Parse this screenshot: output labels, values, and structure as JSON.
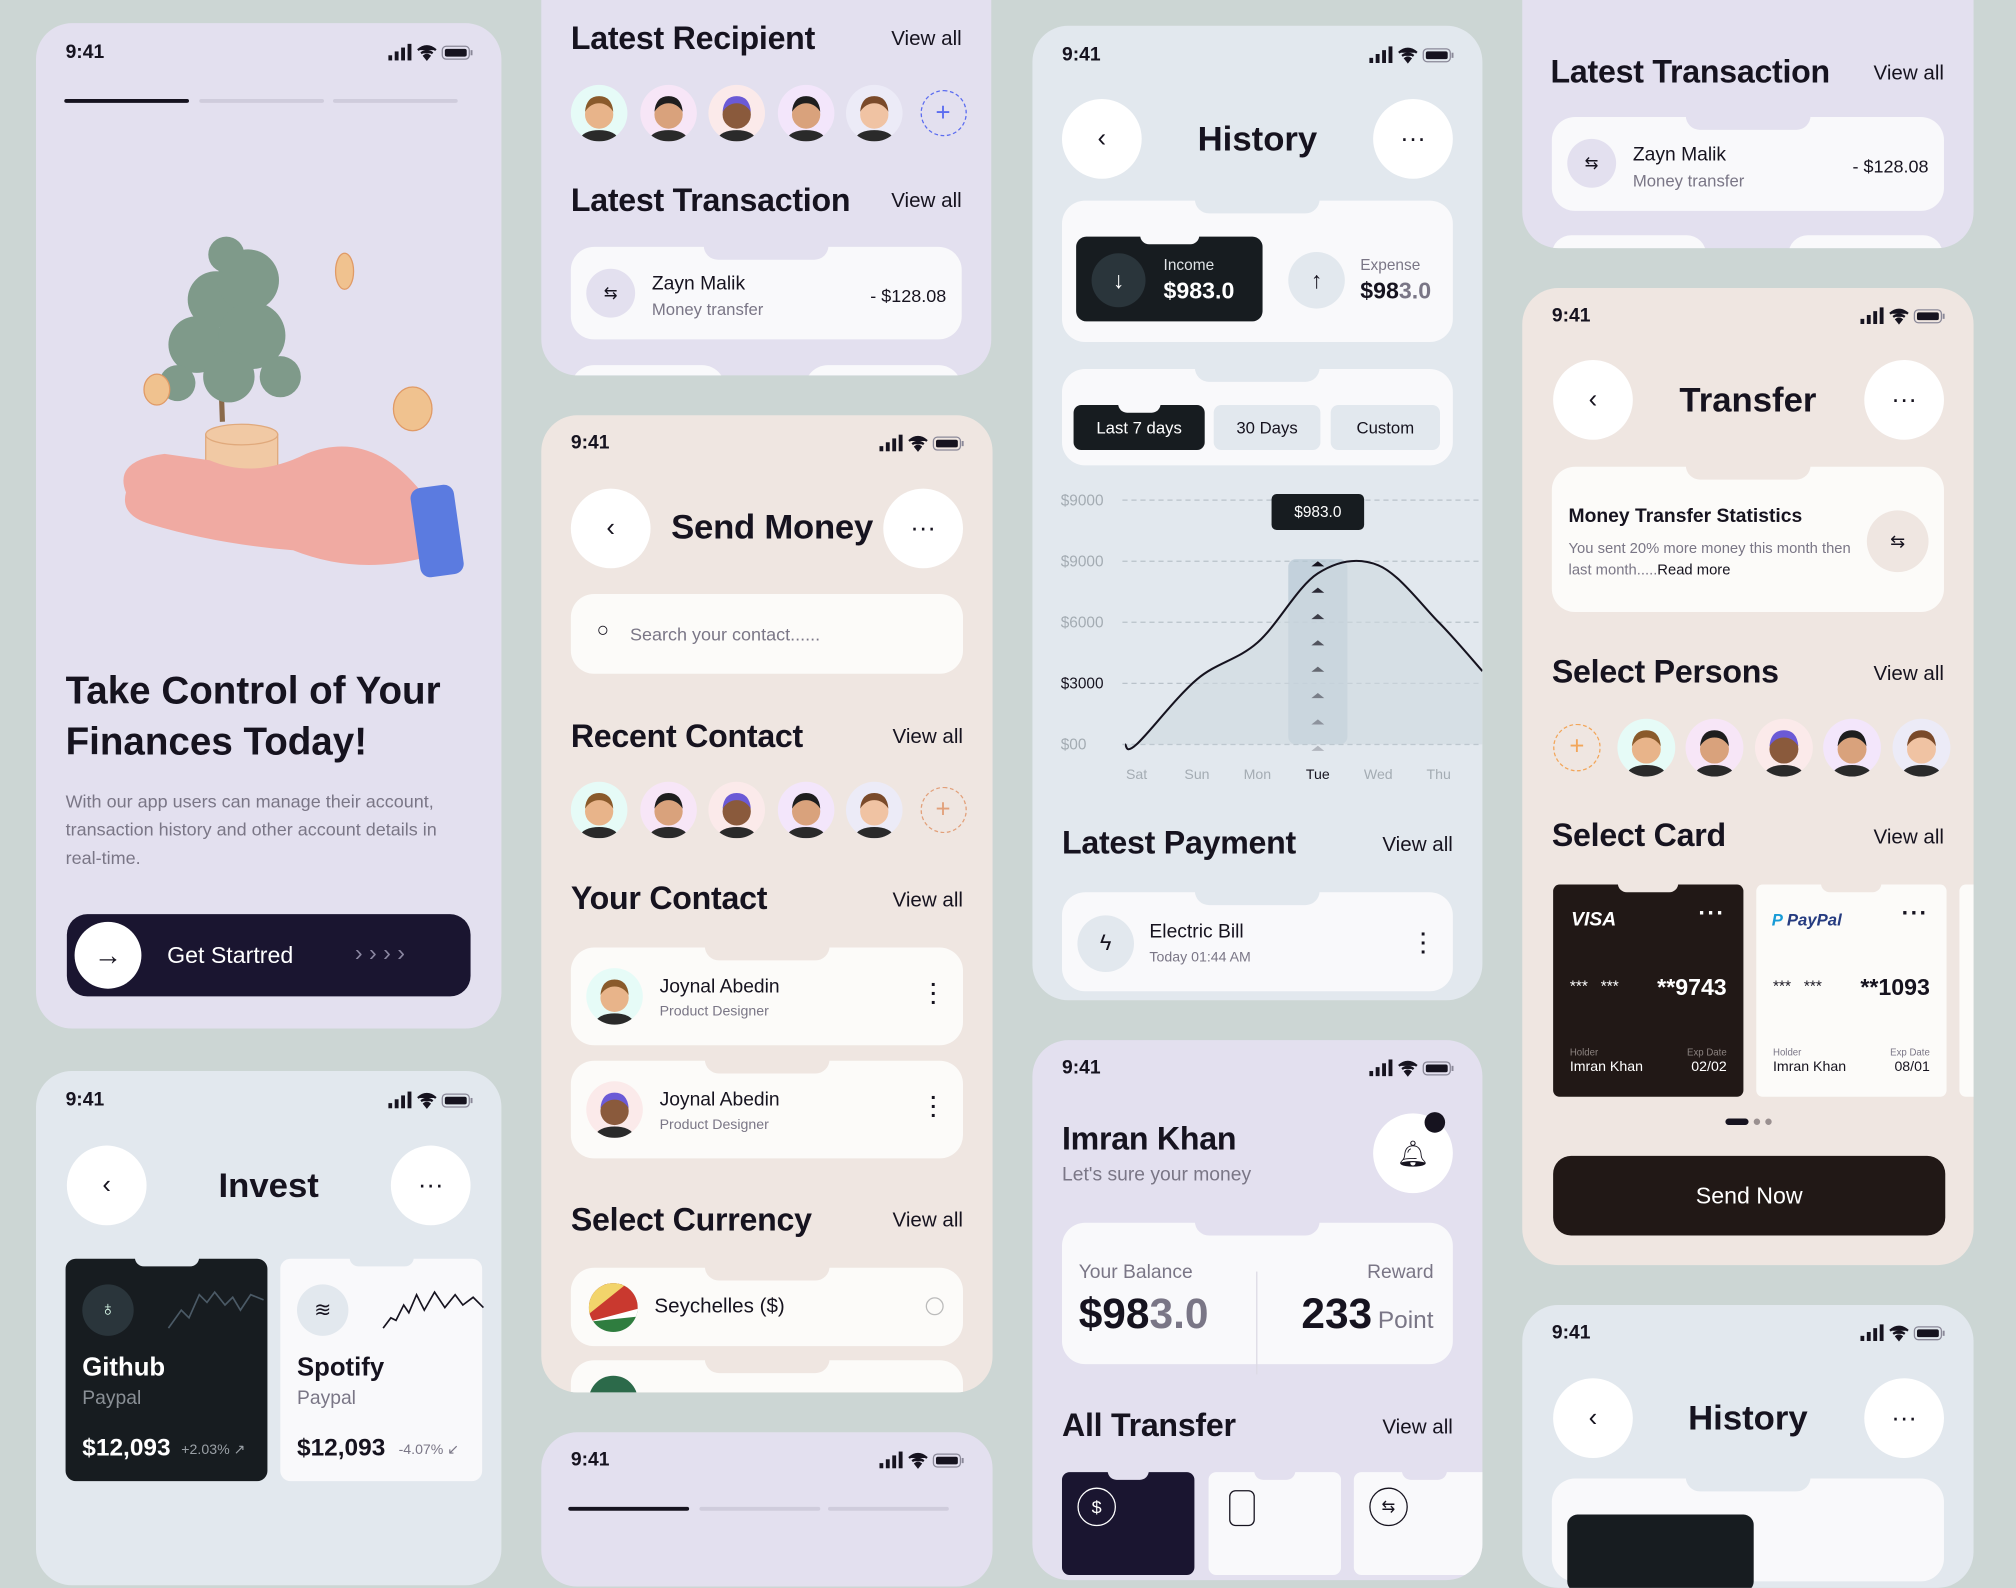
{
  "status": {
    "time": "9:41"
  },
  "common": {
    "view_all": "View all",
    "more": "···",
    "back": "‹"
  },
  "onboarding": {
    "headline_1": "Take Control of Your",
    "headline_2": "Finances Today!",
    "description": "With our app users can manage their account, transaction history and other account details in real-time.",
    "cta": "Get Startred",
    "cta_chevrons": "› › › ›",
    "steps_active": 1,
    "steps_total": 3
  },
  "invest": {
    "title": "Invest",
    "cards": [
      {
        "name": "Github",
        "provider": "Paypal",
        "amount": "$12,093",
        "change": "+2.03% ↗",
        "icon": "github-icon"
      },
      {
        "name": "Spotify",
        "provider": "Paypal",
        "amount": "$12,093",
        "change": "-4.07% ↙",
        "icon": "spotify-icon"
      }
    ]
  },
  "recipients": {
    "latest_recipient": "Latest Recipient",
    "latest_transaction": "Latest Transaction",
    "transaction": {
      "name": "Zayn Malik",
      "type": "Money transfer",
      "amount": "- $128.08"
    }
  },
  "send_money": {
    "title": "Send Money",
    "search_placeholder": "Search your contact......",
    "recent_contact": "Recent Contact",
    "your_contact": "Your Contact",
    "contacts": [
      {
        "name": "Joynal Abedin",
        "role": "Product Designer"
      },
      {
        "name": "Joynal Abedin",
        "role": "Product Designer"
      }
    ],
    "select_currency": "Select Currency",
    "currency": "Seychelles ($)"
  },
  "history": {
    "title": "History",
    "income_label": "Income",
    "income": "$983.0",
    "expense_label": "Expense",
    "expense_main": "$98",
    "expense_dim": "3.0",
    "filters": [
      "Last 7 days",
      "30 Days",
      "Custom"
    ],
    "active_filter": "Last 7 days",
    "tooltip": "$983.0",
    "latest_payment": "Latest Payment",
    "payment": {
      "name": "Electric Bill",
      "time": "Today 01:44 AM"
    }
  },
  "chart_data": {
    "type": "area",
    "categories": [
      "Sat",
      "Sun",
      "Mon",
      "Tue",
      "Wed",
      "Thu"
    ],
    "highlight": "Tue",
    "y_tick_labels": [
      "$00",
      "$3000",
      "$6000",
      "$9000",
      "$9000"
    ],
    "y_ticks": [
      0,
      3000,
      6000,
      9000,
      12000
    ],
    "ylim": [
      0,
      12000
    ],
    "values": [
      0,
      3200,
      5000,
      8400,
      8800,
      6000
    ],
    "grid": "dashed horizontal",
    "xlabel": "",
    "ylabel": ""
  },
  "home": {
    "name": "Imran Khan",
    "subtitle": "Let's sure your money",
    "balance_label": "Your Balance",
    "balance_main": "$98",
    "balance_dim": "3.0",
    "reward_label": "Reward",
    "reward": "233",
    "reward_unit": "Point",
    "all_transfer": "All Transfer"
  },
  "transfer": {
    "title": "Transfer",
    "stats_title": "Money Transfer Statistics",
    "stats_text": "You sent 20% more money this month then last month.....",
    "read_more": "Read more",
    "select_persons": "Select Persons",
    "select_card": "Select Card",
    "cards": [
      {
        "brand": "VISA",
        "masked": "***   ***",
        "last": "**9743",
        "holder_label": "Holder",
        "holder": "Imran Khan",
        "exp_label": "Exp Date",
        "exp": "02/02"
      },
      {
        "brand": "PayPal",
        "masked": "***   ***",
        "last": "**1093",
        "holder_label": "Holder",
        "holder": "Imran Khan",
        "exp_label": "Exp Date",
        "exp": "08/01"
      }
    ],
    "send_now": "Send Now"
  },
  "history2": {
    "title": "History"
  },
  "avatars": [
    {
      "bg": "#e6fbf7",
      "skin": "#e8b48a",
      "hair": "#8a5a2b"
    },
    {
      "bg": "#f7e6f7",
      "skin": "#d9a27c",
      "hair": "#1e1e1e"
    },
    {
      "bg": "#fbeaea",
      "skin": "#8a5a3c",
      "hair": "#6b5ad6"
    },
    {
      "bg": "#f3e6fb",
      "skin": "#d9a27c",
      "hair": "#1e1e1e"
    },
    {
      "bg": "#ecebf7",
      "skin": "#f0c3a3",
      "hair": "#7a4a2a"
    }
  ],
  "colors": {
    "dark": "#171c20",
    "navy": "#1a1530",
    "brown_dark": "#211816",
    "accent_blue": "#5b6cf0",
    "accent_orange": "#f2a65a"
  }
}
